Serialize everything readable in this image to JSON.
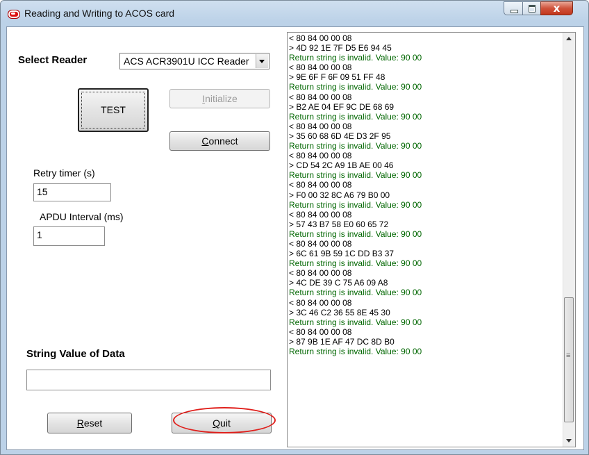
{
  "window": {
    "title": "Reading and Writing to ACOS card"
  },
  "controls": {
    "minimize": "minimize",
    "maximize": "maximize",
    "close": "x"
  },
  "reader": {
    "label": "Select Reader",
    "value": "ACS ACR3901U ICC Reader"
  },
  "buttons": {
    "test": "TEST",
    "initialize_prefix": "I",
    "initialize_rest": "nitialize",
    "connect_prefix": "C",
    "connect_rest": "onnect",
    "reset_prefix": "R",
    "reset_rest": "eset",
    "quit_prefix": "Q",
    "quit_rest": "uit"
  },
  "retry": {
    "label": "Retry timer (s)",
    "value": "15"
  },
  "apdu": {
    "label": "APDU Interval (ms)",
    "value": "1"
  },
  "string_value": {
    "label": "String Value of Data",
    "value": ""
  },
  "log": [
    {
      "t": "< 80 84 00 00 08",
      "k": "cmd"
    },
    {
      "t": "> 4D 92 1E 7F D5 E6 94 45",
      "k": "cmd"
    },
    {
      "t": "Return string is invalid. Value: 90 00",
      "k": "resp"
    },
    {
      "t": "< 80 84 00 00 08",
      "k": "cmd"
    },
    {
      "t": "> 9E 6F F 6F 09 51 FF 48",
      "k": "cmd"
    },
    {
      "t": "Return string is invalid. Value: 90 00",
      "k": "resp"
    },
    {
      "t": "< 80 84 00 00 08",
      "k": "cmd"
    },
    {
      "t": "> B2 AE 04 EF 9C DE 68 69",
      "k": "cmd"
    },
    {
      "t": "Return string is invalid. Value: 90 00",
      "k": "resp"
    },
    {
      "t": "< 80 84 00 00 08",
      "k": "cmd"
    },
    {
      "t": "> 35 60 68 6D 4E D3 2F 95",
      "k": "cmd"
    },
    {
      "t": "Return string is invalid. Value: 90 00",
      "k": "resp"
    },
    {
      "t": "< 80 84 00 00 08",
      "k": "cmd"
    },
    {
      "t": "> CD 54 2C A9 1B AE 00 46",
      "k": "cmd"
    },
    {
      "t": "Return string is invalid. Value: 90 00",
      "k": "resp"
    },
    {
      "t": "< 80 84 00 00 08",
      "k": "cmd"
    },
    {
      "t": "> F0 00 32 8C A6 79 B0 00",
      "k": "cmd"
    },
    {
      "t": "Return string is invalid. Value: 90 00",
      "k": "resp"
    },
    {
      "t": "< 80 84 00 00 08",
      "k": "cmd"
    },
    {
      "t": "> 57 43 B7 58 E0 60 65 72",
      "k": "cmd"
    },
    {
      "t": "Return string is invalid. Value: 90 00",
      "k": "resp"
    },
    {
      "t": "< 80 84 00 00 08",
      "k": "cmd"
    },
    {
      "t": "> 6C 61 9B 59 1C DD B3 37",
      "k": "cmd"
    },
    {
      "t": "Return string is invalid. Value: 90 00",
      "k": "resp"
    },
    {
      "t": "< 80 84 00 00 08",
      "k": "cmd"
    },
    {
      "t": "> 4C DE 39 C 75 A6 09 A8",
      "k": "cmd"
    },
    {
      "t": "Return string is invalid. Value: 90 00",
      "k": "resp"
    },
    {
      "t": "< 80 84 00 00 08",
      "k": "cmd"
    },
    {
      "t": "> 3C 46 C2 36 55 8E 45 30",
      "k": "cmd"
    },
    {
      "t": "Return string is invalid. Value: 90 00",
      "k": "resp"
    },
    {
      "t": "< 80 84 00 00 08",
      "k": "cmd"
    },
    {
      "t": "> 87 9B 1E AF 47 DC 8D B0",
      "k": "cmd"
    },
    {
      "t": "Return string is invalid. Value: 90 00",
      "k": "resp"
    }
  ],
  "colors": {
    "response_text": "#006600",
    "highlight_ellipse": "#e0201c"
  }
}
